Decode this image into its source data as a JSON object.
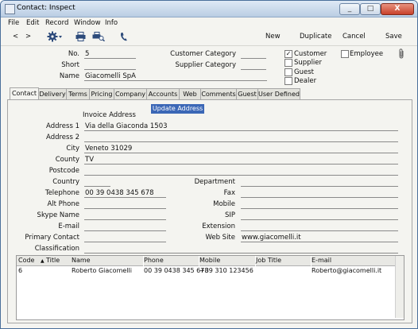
{
  "window": {
    "title": "Contact: Inspect",
    "min": "_",
    "max": "□",
    "close": "X"
  },
  "menu": [
    "File",
    "Edit",
    "Record",
    "Window",
    "Info"
  ],
  "toolbar": {
    "prev": "<",
    "next": ">",
    "new": "New",
    "duplicate": "Duplicate",
    "cancel": "Cancel",
    "save": "Save"
  },
  "header": {
    "no_label": "No.",
    "no_value": "5",
    "short_label": "Short",
    "short_value": "",
    "name_label": "Name",
    "name_value": "Giacomelli SpA",
    "customer_category_label": "Customer Category",
    "customer_category_value": "",
    "supplier_category_label": "Supplier Category",
    "supplier_category_value": "",
    "checks": [
      {
        "label": "Customer",
        "checked": true
      },
      {
        "label": "Supplier",
        "checked": false
      },
      {
        "label": "Guest",
        "checked": false
      },
      {
        "label": "Dealer",
        "checked": false
      }
    ],
    "employee": {
      "label": "Employee",
      "checked": false
    }
  },
  "tabs": [
    "Contact",
    "Delivery",
    "Terms",
    "Pricing",
    "Company",
    "Accounts",
    "Web",
    "Comments",
    "Guest",
    "User Defined"
  ],
  "active_tab": "Contact",
  "contact": {
    "invoice_address_label": "Invoice Address",
    "update_address_button": "Update Address",
    "address1_label": "Address 1",
    "address1_value": "Via della Giaconda 1503",
    "address2_label": "Address 2",
    "address2_value": "",
    "city_label": "City",
    "city_value": "Veneto 31029",
    "county_label": "County",
    "county_value": "TV",
    "postcode_label": "Postcode",
    "postcode_value": "",
    "country_label": "Country",
    "country_value": "",
    "telephone_label": "Telephone",
    "telephone_value": "00 39 0438 345 678",
    "alt_phone_label": "Alt Phone",
    "alt_phone_value": "",
    "skype_label": "Skype Name",
    "skype_value": "",
    "email_label": "E-mail",
    "email_value": "",
    "primary_contact_label": "Primary Contact",
    "primary_contact_value": "",
    "classification_label": "Classification",
    "classification_value": "",
    "department_label": "Department",
    "department_value": "",
    "fax_label": "Fax",
    "fax_value": "",
    "mobile_label": "Mobile",
    "mobile_value": "",
    "sip_label": "SIP",
    "sip_value": "",
    "extension_label": "Extension",
    "extension_value": "",
    "website_label": "Web Site",
    "website_value": "www.giacomelli.it"
  },
  "grid": {
    "columns": [
      "Code",
      "Title",
      "Name",
      "Phone",
      "Mobile",
      "Job Title",
      "E-mail"
    ],
    "sort_indicator": "▲",
    "rows": [
      {
        "code": "6",
        "title": "",
        "name": "Roberto Giacomelli",
        "phone": "00 39 0438 345 678",
        "mobile": "+39 310 123456",
        "job_title": "",
        "email": "Roberto@giacomelli.it"
      }
    ]
  },
  "colors": {
    "accent": "#3b67b6",
    "title_bar": "#c9d8ea",
    "close": "#c8412a"
  },
  "icons": [
    "gear-icon",
    "printer-icon",
    "print-preview-icon",
    "phone-icon",
    "paperclip-icon"
  ]
}
